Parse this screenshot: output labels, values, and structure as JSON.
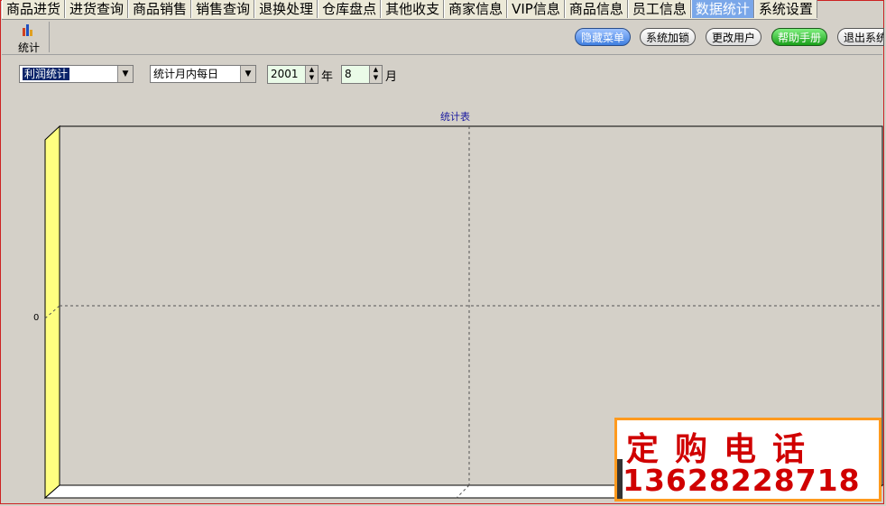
{
  "menu": {
    "tabs": [
      "商品进货",
      "进货查询",
      "商品销售",
      "销售查询",
      "退换处理",
      "仓库盘点",
      "其他收支",
      "商家信息",
      "VIP信息",
      "商品信息",
      "员工信息",
      "数据统计",
      "系统设置"
    ],
    "active": "数据统计"
  },
  "toolbar": {
    "stat_label": "统计",
    "hide_menu": "隐藏菜单",
    "lock": "系统加锁",
    "change_user": "更改用户",
    "help": "帮助手册",
    "exit": "退出系统"
  },
  "controls": {
    "report_type": "利润统计",
    "period": "统计月内每日",
    "year": "2001",
    "year_unit": "年",
    "month": "8",
    "month_unit": "月"
  },
  "chart_data": {
    "type": "bar",
    "title": "统计表",
    "categories": [],
    "series": [],
    "yticks": [
      "0"
    ],
    "grid": true
  },
  "ad": {
    "line1": "定购电话",
    "line2": "13628228718"
  },
  "colors": {
    "active_tab": "#7aa7e9",
    "wall": "#ffff80",
    "title": "#1a1aa0",
    "ad_text": "#d00000",
    "ad_border": "#ff9a1e"
  }
}
